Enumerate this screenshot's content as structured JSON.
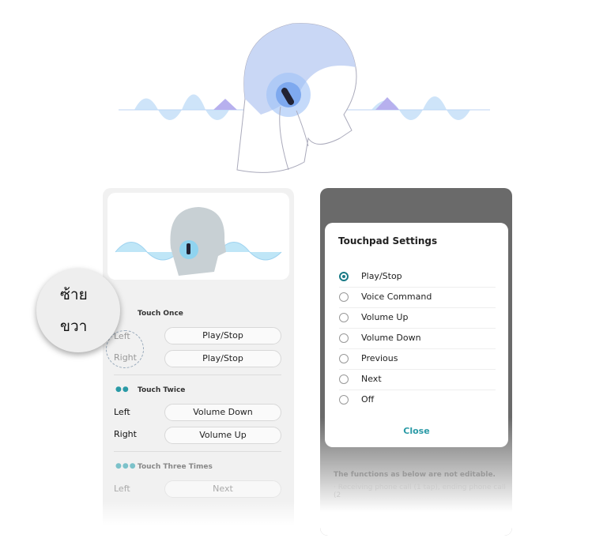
{
  "left_panel": {
    "callout": {
      "left": "ซ้าย",
      "right": "ขวา"
    },
    "sections": [
      {
        "title": "Touch Once",
        "dots": "",
        "rows": [
          {
            "side": "Left",
            "value": "Play/Stop"
          },
          {
            "side": "Right",
            "value": "Play/Stop"
          }
        ]
      },
      {
        "title": "Touch Twice",
        "dots": "●●",
        "rows": [
          {
            "side": "Left",
            "value": "Volume Down"
          },
          {
            "side": "Right",
            "value": "Volume Up"
          }
        ]
      },
      {
        "title": "Touch Three Times",
        "dots": "●●●",
        "rows": [
          {
            "side": "Left",
            "value": "Next"
          }
        ]
      }
    ]
  },
  "dialog": {
    "title": "Touchpad Settings",
    "options": [
      "Play/Stop",
      "Voice Command",
      "Volume Up",
      "Volume Down",
      "Previous",
      "Next",
      "Off"
    ],
    "selected": "Play/Stop",
    "close_label": "Close"
  },
  "background_screen": {
    "note": "The functions as below are not editable.",
    "note_detail": "· Receiving phone call (1 tap), ending phone call (2"
  },
  "colors": {
    "accent": "#2a9aa6",
    "wave": "#a9c8f5",
    "head": "#c9d7f5"
  }
}
